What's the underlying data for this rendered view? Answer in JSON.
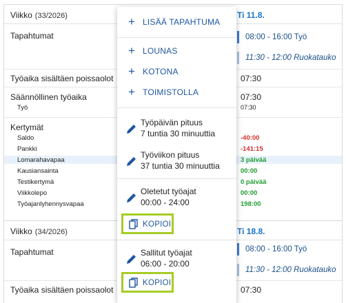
{
  "week1": {
    "label": "Viikko",
    "number": "(33/2026)",
    "day": "Ti 11.8.",
    "rows": {
      "events": "Tapahtumat",
      "worktime_incl": "Työaika sisältäen poissaolot",
      "regular": "Säännöllinen työaika",
      "regular_sub": "Työ",
      "accruals": "Kertymät"
    },
    "events": [
      {
        "text": "08:00 - 16:00 Työ"
      },
      {
        "text": "11:30 - 12:00 Ruokatauko"
      }
    ],
    "worktime_incl_value": "07:30",
    "regular_value": "07:30",
    "regular_sub_value": "07:30",
    "accruals": [
      {
        "label": "Saldo",
        "value": "-40:00",
        "color": "#d0312d"
      },
      {
        "label": "Pankki",
        "value": "-141:15",
        "color": "#d0312d"
      },
      {
        "label": "Lomarahavapaa",
        "value": "3 päivää",
        "color": "#1f9d2f"
      },
      {
        "label": "Kausiansainta",
        "value": "00:00",
        "color": "#1f9d2f"
      },
      {
        "label": "Testikertymä",
        "value": "0 päivää",
        "color": "#1f9d2f"
      },
      {
        "label": "Viikkolepo",
        "value": "00:00",
        "color": "#1f9d2f"
      },
      {
        "label": "Työajanlyhennysvapaa",
        "value": "198:00",
        "color": "#1f9d2f"
      }
    ]
  },
  "week2": {
    "label": "Viikko",
    "number": "(34/2026)",
    "day": "Ti 18.8.",
    "rows": {
      "events": "Tapahtumat",
      "worktime_incl": "Työaika sisältäen poissaolot"
    },
    "events": [
      {
        "text": "08:00 - 16:00 Työ"
      },
      {
        "text": "11:30 - 12:00 Ruokatauko"
      }
    ],
    "worktime_incl_value": "07:30"
  },
  "menu": {
    "add_event": "LISÄÄ TAPAHTUMA",
    "lunch": "LOUNAS",
    "home": "KOTONA",
    "office": "TOIMISTOLLA",
    "workday_title": "Työpäivän pituus",
    "workday_value": "7 tuntia 30 minuuttia",
    "workweek_title": "Työviikon pituus",
    "workweek_value": "37 tuntia 30 minuuttia",
    "default_title": "Oletetut työajat",
    "default_value": "00:00 - 24:00",
    "copy1": "KOPIOI",
    "allowed_title": "Sallitut työajat",
    "allowed_value": "06:00 - 20:00",
    "copy2": "KOPIOI"
  },
  "icons": {
    "add": "plus-icon",
    "edit": "pencil-icon",
    "copy": "copy-icon"
  },
  "colors": {
    "accent": "#1e56a0",
    "event_bar": "#3a7bc8",
    "highlight": "#a6cc24",
    "negative": "#d0312d",
    "positive": "#1f9d2f"
  }
}
